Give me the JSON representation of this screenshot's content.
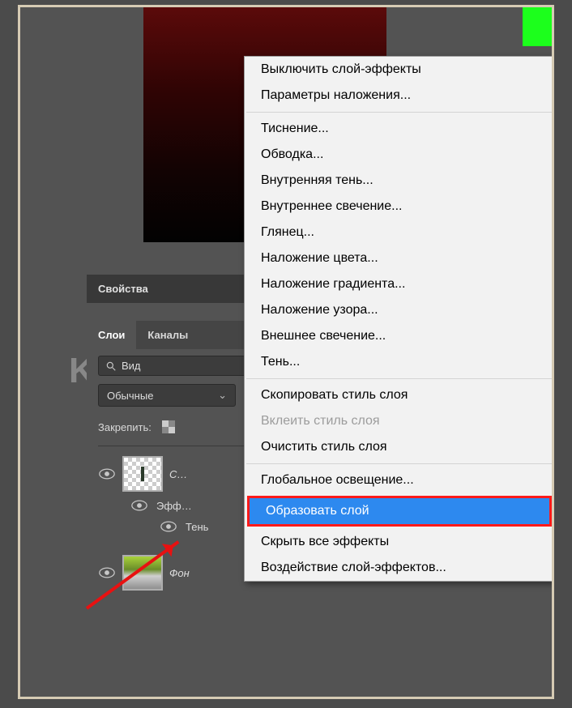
{
  "watermark": "KAK-SDELAT.ORG",
  "panels": {
    "properties_tab": "Свойства",
    "tabs": {
      "layers": "Слои",
      "channels": "Каналы"
    },
    "search_label": "Вид",
    "blend_mode": "Обычные",
    "lock_label": "Закрепить:"
  },
  "layers": {
    "layer1_name": "С…",
    "effects_label": "Эфф…",
    "shadow_label": "Тень",
    "background_name": "Фон"
  },
  "context_menu": {
    "group1": [
      "Выключить слой-эффекты",
      "Параметры наложения..."
    ],
    "group2": [
      "Тиснение...",
      "Обводка...",
      "Внутренняя тень...",
      "Внутреннее свечение...",
      "Глянец...",
      "Наложение цвета...",
      "Наложение градиента...",
      "Наложение узора...",
      "Внешнее свечение...",
      "Тень..."
    ],
    "group3": {
      "copy": "Скопировать стиль слоя",
      "paste_disabled": "Вклеить стиль слоя",
      "clear": "Очистить стиль слоя"
    },
    "group4": {
      "global_light": "Глобальное освещение...",
      "create_layer": "Образовать слой",
      "hide_all": "Скрыть все эффекты",
      "scale": "Воздействие слой-эффектов..."
    }
  }
}
